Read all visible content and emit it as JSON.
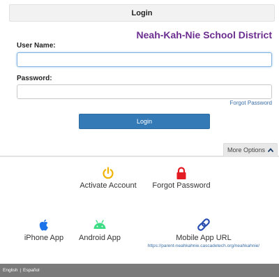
{
  "header": {
    "title": "Login"
  },
  "district": {
    "name": "Neah-Kah-Nie School District"
  },
  "form": {
    "username_label": "User Name:",
    "username_value": "",
    "password_label": "Password:",
    "password_value": "",
    "forgot_password_link": "Forgot Password",
    "login_button": "Login"
  },
  "more_options": {
    "label": "More Options",
    "icon": "chevron-up-icon"
  },
  "options": {
    "activate": {
      "label": "Activate Account",
      "icon": "power-icon",
      "color": "#f0b400"
    },
    "forgot": {
      "label": "Forgot Password",
      "icon": "lock-icon",
      "color": "#e31b23"
    },
    "iphone": {
      "label": "iPhone App",
      "icon": "apple-icon",
      "color": "#1a73e8"
    },
    "android": {
      "label": "Android App",
      "icon": "android-icon",
      "color": "#3ddc84"
    },
    "mobile_url": {
      "label": "Mobile App URL",
      "url": "https://parent-neahkahnie.cascadetech.org/neahkahnie/",
      "icon": "link-icon",
      "color": "#2a4fb0"
    }
  },
  "footer": {
    "lang_english": "English",
    "separator": "|",
    "lang_spanish": "Español"
  },
  "colors": {
    "accent": "#337ab7",
    "district": "#6b2d8f",
    "footer": "#7a7a7a"
  }
}
